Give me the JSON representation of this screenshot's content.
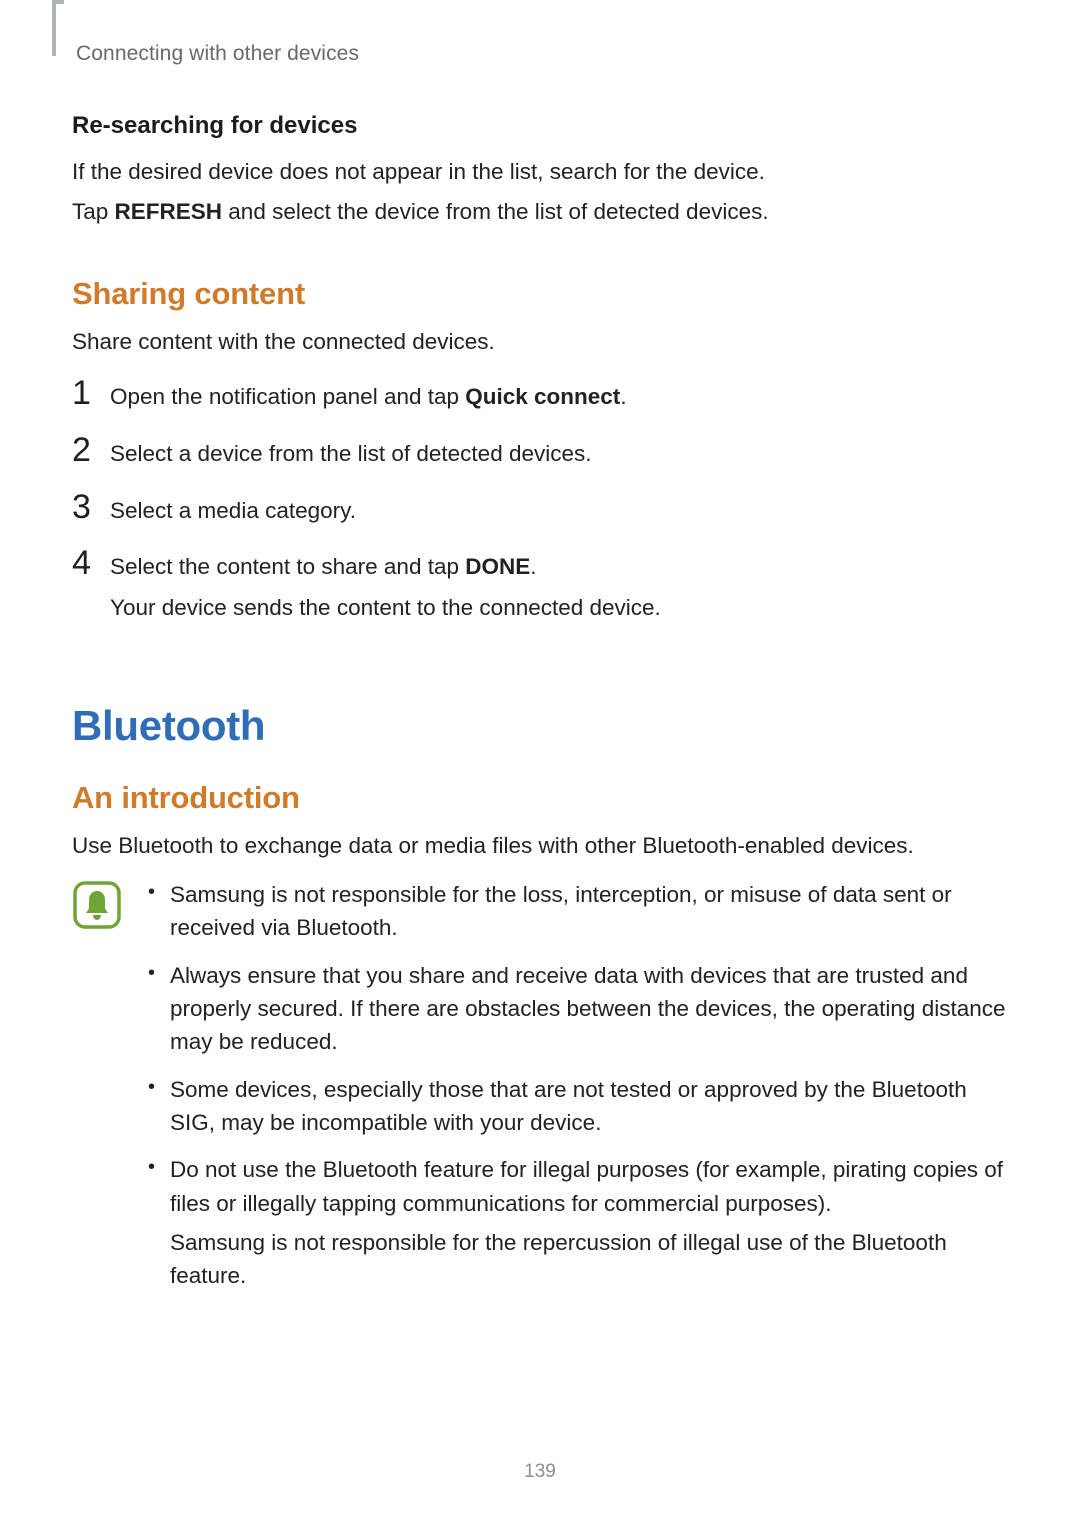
{
  "running_head": "Connecting with other devices",
  "resarch": {
    "heading": "Re-searching for devices",
    "line1": "If the desired device does not appear in the list, search for the device.",
    "line2_pre": "Tap ",
    "line2_bold": "REFRESH",
    "line2_post": " and select the device from the list of detected devices."
  },
  "sharing": {
    "heading": "Sharing content",
    "intro": "Share content with the connected devices.",
    "steps": [
      {
        "n": "1",
        "pre": "Open the notification panel and tap ",
        "bold": "Quick connect",
        "post": "."
      },
      {
        "n": "2",
        "text": "Select a device from the list of detected devices."
      },
      {
        "n": "3",
        "text": "Select a media category."
      },
      {
        "n": "4",
        "pre": "Select the content to share and tap ",
        "bold": "DONE",
        "post": ".",
        "sub": "Your device sends the content to the connected device."
      }
    ]
  },
  "bluetooth": {
    "heading": "Bluetooth",
    "intro_heading": "An introduction",
    "intro_text": "Use Bluetooth to exchange data or media files with other Bluetooth-enabled devices.",
    "notes": [
      "Samsung is not responsible for the loss, interception, or misuse of data sent or received via Bluetooth.",
      "Always ensure that you share and receive data with devices that are trusted and properly secured. If there are obstacles between the devices, the operating distance may be reduced.",
      "Some devices, especially those that are not tested or approved by the Bluetooth SIG, may be incompatible with your device."
    ],
    "note4_a": "Do not use the Bluetooth feature for illegal purposes (for example, pirating copies of files or illegally tapping communications for commercial purposes).",
    "note4_b": "Samsung is not responsible for the repercussion of illegal use of the Bluetooth feature."
  },
  "page_number": "139"
}
